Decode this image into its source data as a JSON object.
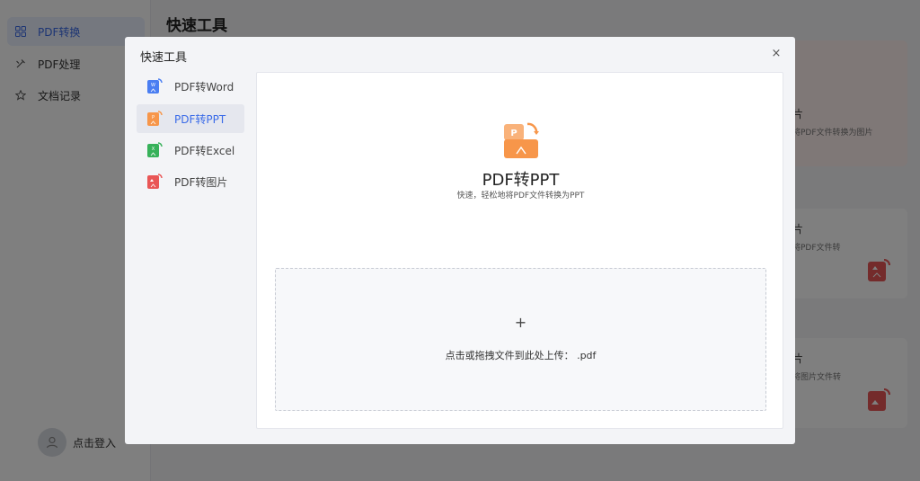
{
  "sidebar": {
    "items": [
      {
        "label": "PDF转换",
        "icon": "grid-icon",
        "active": true
      },
      {
        "label": "PDF处理",
        "icon": "tools-icon",
        "active": false
      },
      {
        "label": "文档记录",
        "icon": "star-icon",
        "active": false
      }
    ],
    "login_label": "点击登入"
  },
  "main": {
    "title": "快速工具",
    "cards": [
      {
        "title": "片",
        "desc": "将PDF文件转换为图片"
      },
      {
        "title": "片",
        "desc": "将PDF文件转"
      },
      {
        "title": "片",
        "desc": "将图片文件转"
      }
    ]
  },
  "modal": {
    "title": "快速工具",
    "close_icon": "×",
    "tools": [
      {
        "label": "PDF转Word",
        "color": "#4a7ef2",
        "letter": "W"
      },
      {
        "label": "PDF转PPT",
        "color": "#f7964a",
        "letter": "P"
      },
      {
        "label": "PDF转Excel",
        "color": "#37b15a",
        "letter": "X"
      },
      {
        "label": "PDF转图片",
        "color": "#e95656",
        "letter": "▲"
      }
    ],
    "selected_index": 1,
    "hero": {
      "title": "PDF转PPT",
      "subtitle": "快速，轻松地将PDF文件转换为PPT",
      "letter": "P",
      "color": "#f7964a"
    },
    "upload": {
      "plus": "+",
      "text": "点击或拖拽文件到此处上传：  .pdf"
    }
  },
  "colors": {
    "accent": "#3a6be8",
    "overlay": "rgba(0,0,0,0.5)"
  }
}
